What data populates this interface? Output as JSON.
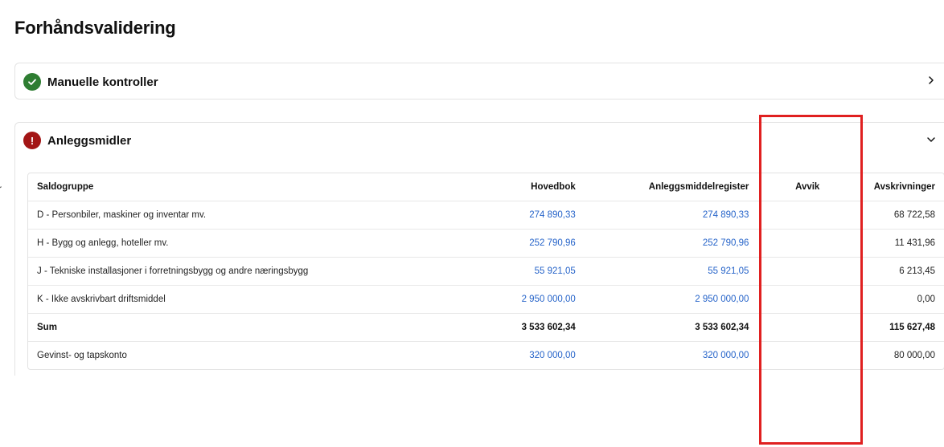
{
  "page": {
    "title": "Forhåndsvalidering",
    "left_stub_text": "r"
  },
  "manual_checks": {
    "title": "Manuelle kontroller",
    "status_icon": "check-icon",
    "status_color": "#2e7d32",
    "chevron_icon": "chevron-right-icon"
  },
  "assets": {
    "title": "Anleggsmidler",
    "status_icon": "error-icon",
    "status_glyph": "!",
    "status_color": "#a31515",
    "chevron_icon": "chevron-down-icon",
    "table": {
      "headers": [
        "Saldogruppe",
        "Hovedbok",
        "Anleggsmiddelregister",
        "Avvik",
        "Avskrivninger"
      ],
      "rows": [
        {
          "group": "D - Personbiler, maskiner og inventar mv.",
          "ledger": "274 890,33",
          "register": "274 890,33",
          "deviation": "",
          "depreciation": "68 722,58"
        },
        {
          "group": "H - Bygg og anlegg, hoteller mv.",
          "ledger": "252 790,96",
          "register": "252 790,96",
          "deviation": "",
          "depreciation": "11 431,96"
        },
        {
          "group": "J - Tekniske installasjoner i forretningsbygg og andre næringsbygg",
          "ledger": "55 921,05",
          "register": "55 921,05",
          "deviation": "",
          "depreciation": "6 213,45"
        },
        {
          "group": "K - Ikke avskrivbart driftsmiddel",
          "ledger": "2 950 000,00",
          "register": "2 950 000,00",
          "deviation": "",
          "depreciation": "0,00"
        },
        {
          "group": "Sum",
          "ledger": "3 533 602,34",
          "register": "3 533 602,34",
          "deviation": "",
          "depreciation": "115 627,48"
        },
        {
          "group": "Gevinst- og tapskonto",
          "ledger": "320 000,00",
          "register": "320 000,00",
          "deviation": "",
          "depreciation": "80 000,00"
        }
      ]
    }
  },
  "colors": {
    "link": "#2563c9",
    "highlight": "#e02020"
  }
}
